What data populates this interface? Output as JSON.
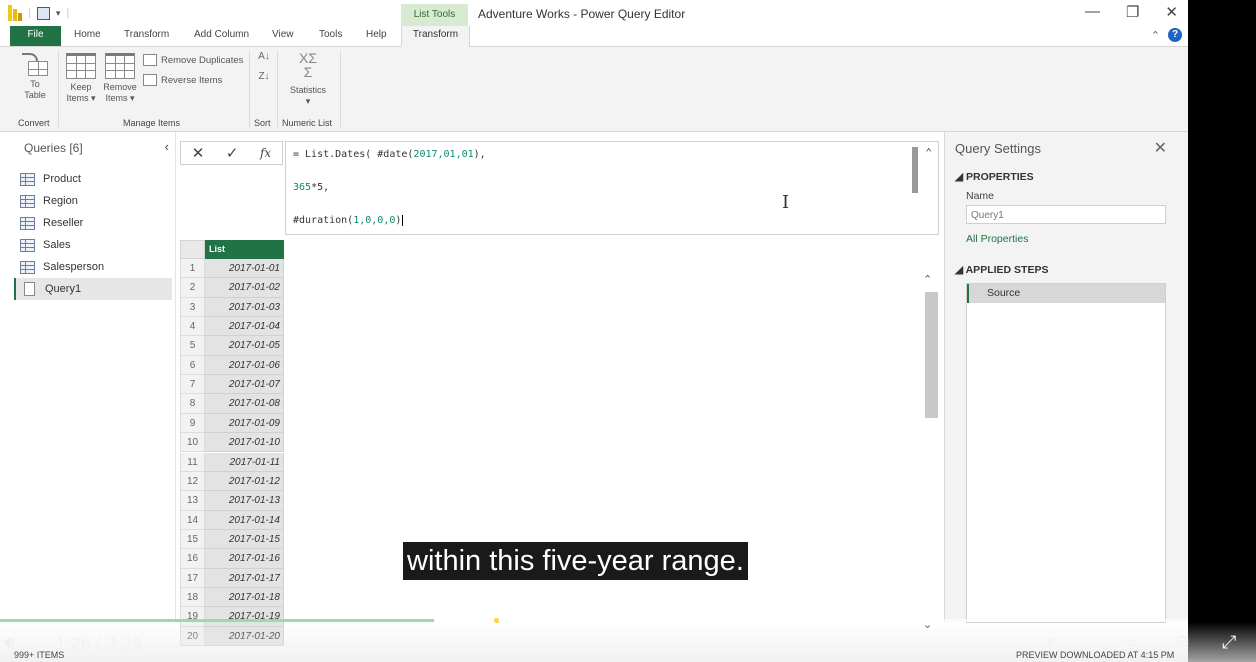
{
  "window": {
    "title": "Adventure Works - Power Query Editor",
    "context_tab_group": "List Tools",
    "minimize": "—",
    "restore": "❐",
    "close": "✕"
  },
  "tabs": {
    "file": "File",
    "home": "Home",
    "transform_main": "Transform",
    "add_column": "Add Column",
    "view": "View",
    "tools": "Tools",
    "help": "Help",
    "transform_active": "Transform",
    "help_icon": "?"
  },
  "ribbon": {
    "to_table": [
      "To",
      "Table"
    ],
    "keep_items": [
      "Keep",
      "Items ▾"
    ],
    "remove_items": [
      "Remove",
      "Items ▾"
    ],
    "remove_duplicates": "Remove Duplicates",
    "reverse_items": "Reverse Items",
    "statistics": [
      "Statistics",
      "▾"
    ],
    "statistics_glyph": [
      "XΣ",
      "Σ"
    ],
    "groups": {
      "convert": "Convert",
      "manage_items": "Manage Items",
      "sort": "Sort",
      "numeric_list": "Numeric List"
    }
  },
  "queries": {
    "header": "Queries [6]",
    "items": [
      {
        "label": "Product",
        "icon": "table-icon"
      },
      {
        "label": "Region",
        "icon": "table-icon"
      },
      {
        "label": "Reseller",
        "icon": "table-icon"
      },
      {
        "label": "Sales",
        "icon": "table-icon"
      },
      {
        "label": "Salesperson",
        "icon": "table-icon"
      },
      {
        "label": "Query1",
        "icon": "list-icon",
        "selected": true
      }
    ]
  },
  "formula_bar": {
    "cancel": "✕",
    "commit": "✓",
    "fx": "fx",
    "line1_prefix": "= List.Dates( #date(",
    "line1_args": "2017,01,01",
    "line1_suffix": "),",
    "line2_num": "365",
    "line2_rest": "*5,",
    "line3_prefix": "#duration(",
    "line3_args": "1,0,0,0",
    "line3_suffix": ")"
  },
  "grid": {
    "column_header": "List",
    "rows": [
      {
        "n": "1",
        "v": "2017-01-01"
      },
      {
        "n": "2",
        "v": "2017-01-02"
      },
      {
        "n": "3",
        "v": "2017-01-03"
      },
      {
        "n": "4",
        "v": "2017-01-04"
      },
      {
        "n": "5",
        "v": "2017-01-05"
      },
      {
        "n": "6",
        "v": "2017-01-06"
      },
      {
        "n": "7",
        "v": "2017-01-07"
      },
      {
        "n": "8",
        "v": "2017-01-08"
      },
      {
        "n": "9",
        "v": "2017-01-09"
      },
      {
        "n": "10",
        "v": "2017-01-10"
      },
      {
        "n": "11",
        "v": "2017-01-11"
      },
      {
        "n": "12",
        "v": "2017-01-12"
      },
      {
        "n": "13",
        "v": "2017-01-13"
      },
      {
        "n": "14",
        "v": "2017-01-14"
      },
      {
        "n": "15",
        "v": "2017-01-15"
      },
      {
        "n": "16",
        "v": "2017-01-16"
      },
      {
        "n": "17",
        "v": "2017-01-17"
      },
      {
        "n": "18",
        "v": "2017-01-18"
      },
      {
        "n": "19",
        "v": "2017-01-19"
      },
      {
        "n": "20",
        "v": "2017-01-20"
      }
    ]
  },
  "settings": {
    "title": "Query Settings",
    "properties_header": "◢ PROPERTIES",
    "name_label": "Name",
    "name_value": "Query1",
    "all_properties": "All Properties",
    "applied_steps_header": "◢ APPLIED STEPS",
    "steps": [
      "Source"
    ]
  },
  "caption": "within this five-year range.",
  "video": {
    "time_current": "1:26",
    "time_sep": "/",
    "time_total": "3:39",
    "progress_fraction": 0.365
  },
  "status": {
    "left": "999+ ITEMS",
    "right": "PREVIEW DOWNLOADED AT 4:15 PM"
  }
}
